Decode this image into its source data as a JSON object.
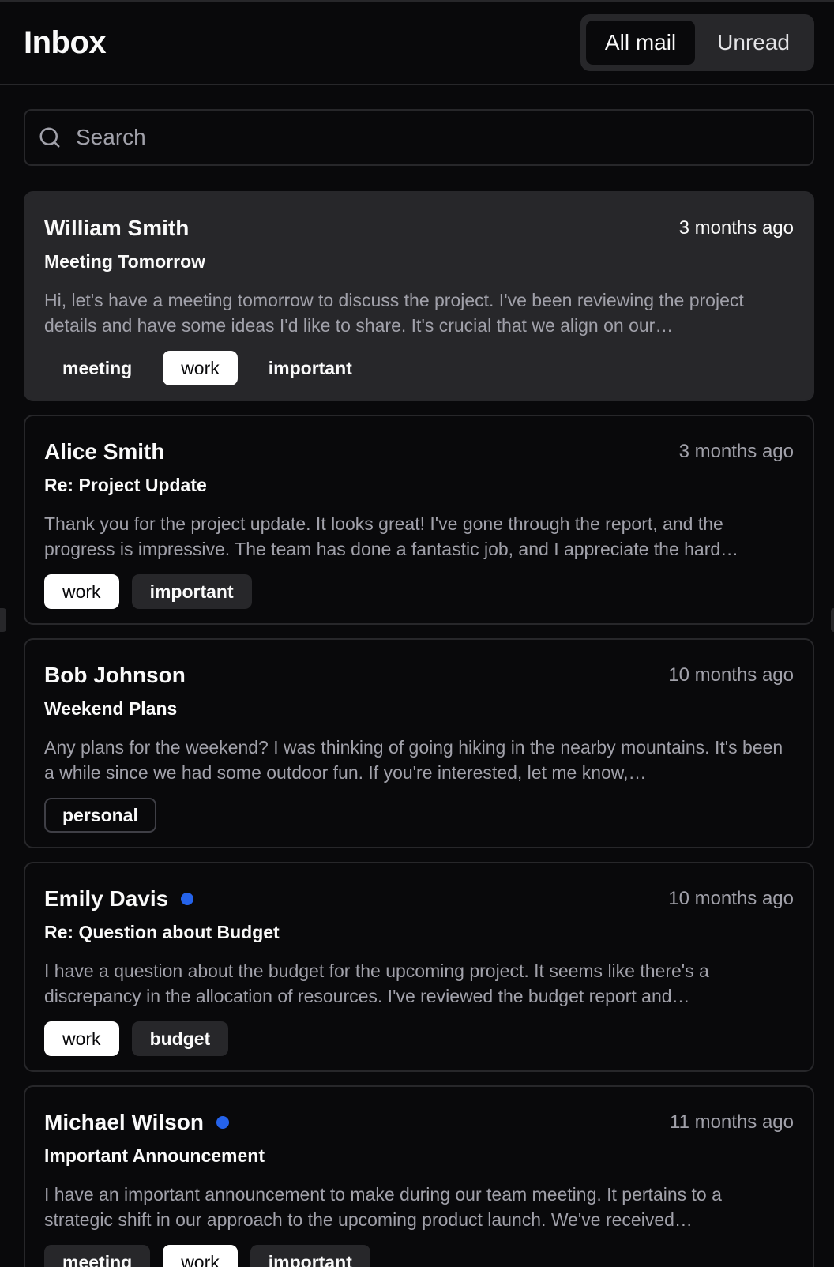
{
  "header": {
    "title": "Inbox",
    "filters": [
      {
        "label": "All mail",
        "active": true
      },
      {
        "label": "Unread",
        "active": false
      }
    ]
  },
  "search": {
    "placeholder": "Search",
    "value": ""
  },
  "colors": {
    "background": "#09090b",
    "border": "#27272a",
    "muted_text": "#a1a1aa",
    "unread_dot": "#2563eb"
  },
  "mails": [
    {
      "sender": "William Smith",
      "unread": false,
      "selected": true,
      "date": "3 months ago",
      "subject": "Meeting Tomorrow",
      "preview": "Hi, let's have a meeting tomorrow to discuss the project. I've been reviewing the project details and have some ideas I'd like to share. It's crucial that we align on our…",
      "tags": [
        {
          "label": "meeting",
          "variant": "secondary"
        },
        {
          "label": "work",
          "variant": "default"
        },
        {
          "label": "important",
          "variant": "secondary"
        }
      ]
    },
    {
      "sender": "Alice Smith",
      "unread": false,
      "selected": false,
      "date": "3 months ago",
      "subject": "Re: Project Update",
      "preview": "Thank you for the project update. It looks great! I've gone through the report, and the progress is impressive. The team has done a fantastic job, and I appreciate the hard…",
      "tags": [
        {
          "label": "work",
          "variant": "default"
        },
        {
          "label": "important",
          "variant": "secondary"
        }
      ]
    },
    {
      "sender": "Bob Johnson",
      "unread": false,
      "selected": false,
      "date": "10 months ago",
      "subject": "Weekend Plans",
      "preview": "Any plans for the weekend? I was thinking of going hiking in the nearby mountains. It's been a while since we had some outdoor fun. If you're interested, let me know,…",
      "tags": [
        {
          "label": "personal",
          "variant": "outline"
        }
      ]
    },
    {
      "sender": "Emily Davis",
      "unread": true,
      "selected": false,
      "date": "10 months ago",
      "subject": "Re: Question about Budget",
      "preview": "I have a question about the budget for the upcoming project. It seems like there's a discrepancy in the allocation of resources. I've reviewed the budget report and…",
      "tags": [
        {
          "label": "work",
          "variant": "default"
        },
        {
          "label": "budget",
          "variant": "secondary"
        }
      ]
    },
    {
      "sender": "Michael Wilson",
      "unread": true,
      "selected": false,
      "date": "11 months ago",
      "subject": "Important Announcement",
      "preview": "I have an important announcement to make during our team meeting. It pertains to a strategic shift in our approach to the upcoming product launch. We've received…",
      "tags": [
        {
          "label": "meeting",
          "variant": "secondary"
        },
        {
          "label": "work",
          "variant": "default"
        },
        {
          "label": "important",
          "variant": "secondary"
        }
      ]
    }
  ]
}
